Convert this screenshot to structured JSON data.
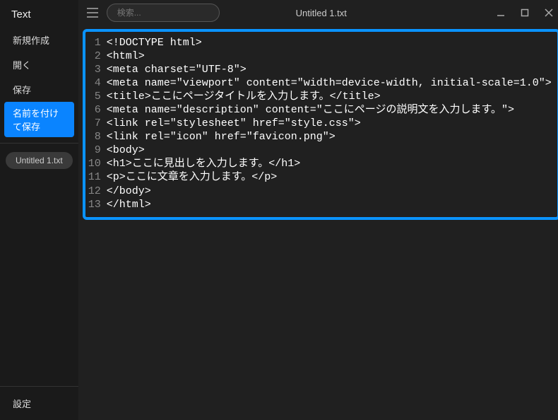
{
  "sidebar": {
    "title": "Text",
    "menu": [
      {
        "label": "新規作成",
        "selected": false
      },
      {
        "label": "開く",
        "selected": false
      },
      {
        "label": "保存",
        "selected": false
      },
      {
        "label": "名前を付けて保存",
        "selected": true
      }
    ],
    "open_file": "Untitled 1.txt",
    "settings_label": "設定"
  },
  "toolbar": {
    "search_placeholder": "検索...",
    "document_title": "Untitled 1.txt"
  },
  "editor": {
    "lines": [
      "<!DOCTYPE html>",
      "<html>",
      "<meta charset=\"UTF-8\">",
      "<meta name=\"viewport\" content=\"width=device-width, initial-scale=1.0\">",
      "<title>ここにページタイトルを入力します。</title>",
      "<meta name=\"description\" content=\"ここにページの説明文を入力します。\">",
      "<link rel=\"stylesheet\" href=\"style.css\">",
      "<link rel=\"icon\" href=\"favicon.png\">",
      "<body>",
      "<h1>ここに見出しを入力します。</h1>",
      "<p>ここに文章を入力します。</p>",
      "</body>",
      "</html>"
    ]
  }
}
